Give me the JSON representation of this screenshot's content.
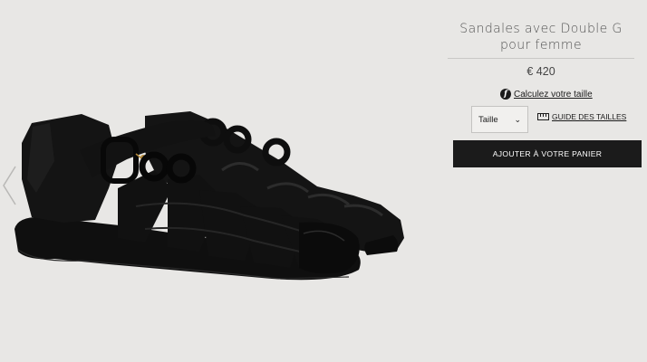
{
  "product": {
    "title": "Sandales avec Double G pour femme",
    "price": "€ 420",
    "image_alt": "Sandales noires en caoutchouc avec Double G"
  },
  "fit": {
    "calc_icon_glyph": "f",
    "calc_label": "Calculez votre taille"
  },
  "size": {
    "select_label": "Taille",
    "chevron_glyph": "⌄",
    "guide_label": "GUIDE DES TAILLES"
  },
  "cart": {
    "button_label": "AJOUTER À VOTRE PANIER"
  },
  "gallery": {
    "prev_icon": "chevron-left-icon"
  },
  "colors": {
    "background": "#e8e7e5",
    "button": "#1b1b1b",
    "text": "#1b1b1b"
  }
}
